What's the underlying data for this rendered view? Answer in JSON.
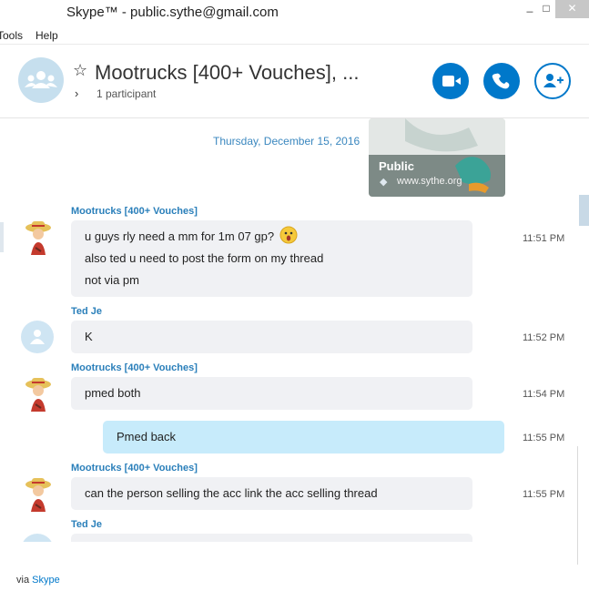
{
  "window": {
    "title": "Skype™ - public.sythe@gmail.com",
    "min_glyph": "_",
    "max_glyph": "□",
    "close_glyph": "✕"
  },
  "menu": [
    "Tools",
    "Help"
  ],
  "header": {
    "chat_title": "Mootrucks [400+ Vouches], ...",
    "participants": "1 participant",
    "star_glyph": "☆",
    "chevron_glyph": "›",
    "icons": [
      "group-avatar-icon",
      "star-icon",
      "chevron-right-icon",
      "video-call-icon",
      "phone-call-icon",
      "add-participant-icon"
    ],
    "accent_color": "#0078ca"
  },
  "date_separator": "Thursday, December 15, 2016",
  "link_card": {
    "title": "Public",
    "url": "www.sythe.org"
  },
  "messages": [
    {
      "sender": "Mootrucks [400+ Vouches]",
      "lines": [
        "u guys rly need a mm for 1m 07 gp?",
        "also ted u need to post the form on my thread",
        "not via pm"
      ],
      "time": "11:51 PM",
      "emoji": "surprised-emoji"
    },
    {
      "sender": "Ted Je",
      "lines": [
        "K"
      ],
      "time": "11:52 PM"
    },
    {
      "sender": "Mootrucks [400+ Vouches]",
      "lines": [
        "pmed both"
      ],
      "time": "11:54 PM"
    },
    {
      "sender": "",
      "lines": [
        "Pmed back"
      ],
      "time": "11:55 PM",
      "outgoing": true
    },
    {
      "sender": "Mootrucks [400+ Vouches]",
      "lines": [
        "can the person selling the acc link the acc selling thread"
      ],
      "time": "11:55 PM"
    },
    {
      "sender": "Ted Je",
      "lines": [],
      "time": ""
    }
  ],
  "footer": {
    "via": "via",
    "via_link": "Skype"
  }
}
